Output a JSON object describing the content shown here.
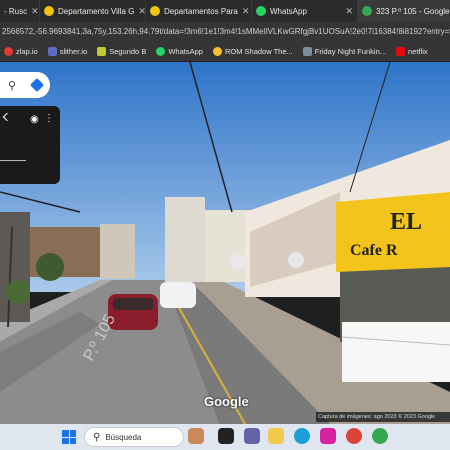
{
  "tabs": [
    {
      "label": "- Rusc",
      "color": "#ea4335",
      "active": false
    },
    {
      "label": "Departamento Villa G",
      "color": "#f1c40f",
      "active": false
    },
    {
      "label": "Departamentos Para",
      "color": "#f1c40f",
      "active": false
    },
    {
      "label": "WhatsApp",
      "color": "#25d366",
      "active": false
    },
    {
      "label": "323 P.º 105 - Google",
      "color": "#34a853",
      "active": true
    }
  ],
  "url": "2566572,-56.9693841,3a,75y,153.26h,94.79t/data=!3m6!1e1!3m4!1sMMeIlVLKwGRfgjBv1UOSuA!2e0!7i16384!8i8192?entry=tt",
  "bookmarks": [
    {
      "label": "zlap.io",
      "color": "#e53935"
    },
    {
      "label": "slither.io",
      "color": "#5c6bc0"
    },
    {
      "label": "Segundo B",
      "color": "#c0ca33"
    },
    {
      "label": "WhatsApp",
      "color": "#25d366"
    },
    {
      "label": "ROM Shadow The...",
      "color": "#fbc02d"
    },
    {
      "label": "Friday Night Funkin...",
      "color": "#78909c"
    },
    {
      "label": "netflix",
      "color": "#e50914"
    }
  ],
  "streetview": {
    "sign_main": "EL",
    "sign_sub": "Cafe R",
    "road_text": "P.º 105",
    "google_logo": "Google",
    "caption": "Captura de imágenes: ago 2023   © 2023 Google"
  },
  "taskbar": {
    "search_placeholder": "Búsqueda"
  }
}
